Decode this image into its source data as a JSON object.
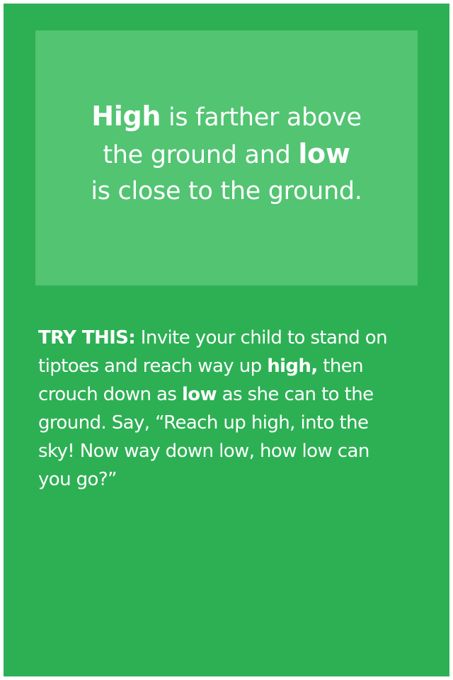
{
  "page": {
    "background_color": "#2db054",
    "frame_color": "#ffffff"
  },
  "definition": {
    "box_color": "#52c472",
    "line1_bold": "High",
    "line1_rest": " is farther above",
    "line2_start": "the ground and ",
    "line2_bold": "low",
    "line3": "is close to the ground."
  },
  "try_this": {
    "label": "TRY THIS:",
    "line1_rest": " Invite your child to stand on",
    "line2_start": "tiptoes and reach way up ",
    "line2_bold": "high,",
    "line2_end": " then",
    "line3_start": "crouch down as ",
    "line3_bold": "low",
    "line3_end": " as she can to the",
    "line4": "ground. Say, “Reach up high, into the",
    "line5": "sky! Now way down low, how low can",
    "line6": "you go?”"
  }
}
